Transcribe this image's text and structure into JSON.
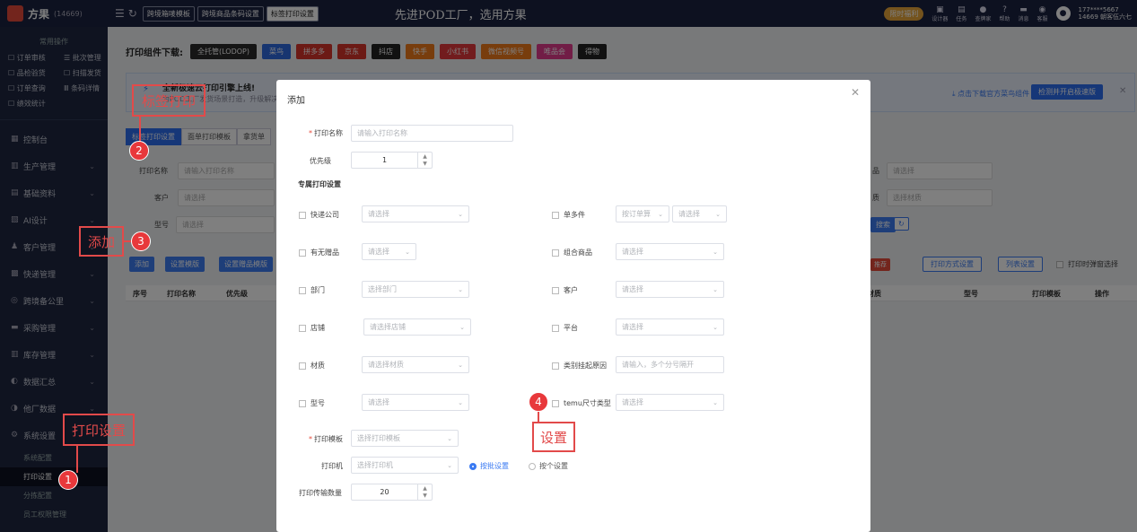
{
  "topbar": {
    "brand": "方果",
    "brand_id": "(14669)",
    "tabs": [
      "跨境箱唛模板",
      "跨境商品条码设置",
      "标签打印设置"
    ],
    "banner": "先进POD工厂，选用方果",
    "promo": "限时福利",
    "icons": [
      {
        "label": "设计器",
        "icon": "design-icon"
      },
      {
        "label": "任务",
        "icon": "task-icon"
      },
      {
        "label": "查牌家",
        "icon": "search-icon"
      },
      {
        "label": "帮助",
        "icon": "help-icon"
      },
      {
        "label": "消息",
        "icon": "message-icon"
      },
      {
        "label": "客服",
        "icon": "service-icon"
      }
    ],
    "user_phone": "177****5667",
    "user_name": "14669 朝客伍六七"
  },
  "sidebar": {
    "section_title": "常用操作",
    "quick": [
      "订单审核",
      "批次管理",
      "品检验货",
      "扫描发货",
      "订单查询",
      "条码详情",
      "绩效统计"
    ],
    "nav": [
      {
        "label": "控制台",
        "icon": "dashboard-icon"
      },
      {
        "label": "生产管理",
        "icon": "production-icon"
      },
      {
        "label": "基础资料",
        "icon": "basic-data-icon"
      },
      {
        "label": "AI设计",
        "icon": "ai-design-icon"
      },
      {
        "label": "客户管理",
        "icon": "customer-icon"
      },
      {
        "label": "快递管理",
        "icon": "express-icon"
      },
      {
        "label": "跨境备公里",
        "icon": "cross-border-icon"
      },
      {
        "label": "采购管理",
        "icon": "purchase-icon"
      },
      {
        "label": "库存管理",
        "icon": "inventory-icon"
      },
      {
        "label": "数据汇总",
        "icon": "data-icon"
      },
      {
        "label": "他厂数据",
        "icon": "other-factory-icon"
      },
      {
        "label": "系统设置",
        "icon": "settings-icon"
      }
    ],
    "sub": [
      "系统配置",
      "打印设置",
      "分拣配置",
      "员工权限管理"
    ]
  },
  "main": {
    "download_label": "打印组件下载:",
    "downloads": [
      {
        "label": "全托管(LODOP)",
        "color": "#2b2b2b"
      },
      {
        "label": "菜鸟",
        "color": "#2f6be0"
      },
      {
        "label": "拼多多",
        "color": "#d9342b"
      },
      {
        "label": "京东",
        "color": "#d9342b"
      },
      {
        "label": "抖店",
        "color": "#222222"
      },
      {
        "label": "快手",
        "color": "#f07a1a"
      },
      {
        "label": "小红书",
        "color": "#e4393c"
      },
      {
        "label": "微信视频号",
        "color": "#f07a1a"
      },
      {
        "label": "唯品会",
        "color": "#e23a8c"
      },
      {
        "label": "得物",
        "color": "#222222"
      }
    ],
    "notice_title": "全新极速云打印引擎上线!",
    "notice_sub": "为POD工厂发货场景打造，升级解决...",
    "notice_link": "点击下载官方菜鸟组件",
    "notice_button": "检测并开启极速版",
    "tabs": [
      "标签打印设置",
      "面单打印模板",
      "拿货单"
    ],
    "filters": {
      "print_name": "打印名称",
      "print_name_ph": "请输入打印名称",
      "customer": "客户",
      "model": "型号",
      "placeholder": "请选择",
      "right_label1": "品",
      "right_label2": "质",
      "right_ph2": "选择材质",
      "search": "搜索",
      "refresh_icon": "refresh-icon"
    },
    "actions": [
      "添加",
      "设置模版",
      "设置赠品模版"
    ],
    "right_actions": {
      "badge": "推荐",
      "print_method": "打印方式设置",
      "columns": "列表设置",
      "remember": "打印时弹窗选择"
    },
    "columns_left": [
      "序号",
      "打印名称",
      "优先级"
    ],
    "columns_right": [
      "材质",
      "型号",
      "打印模板",
      "操作"
    ]
  },
  "modal": {
    "title": "添加",
    "print_name_label": "打印名称",
    "print_name_ph": "请输入打印名称",
    "priority_label": "优先级",
    "priority_value": "1",
    "section": "专属打印设置",
    "left_fields": [
      {
        "label": "快递公司",
        "placeholder": "请选择"
      },
      {
        "label": "有无赠品",
        "placeholder": "请选择"
      },
      {
        "label": "部门",
        "placeholder": "选择部门"
      },
      {
        "label": "店铺",
        "placeholder": "请选择店铺"
      },
      {
        "label": "材质",
        "placeholder": "请选择材质"
      },
      {
        "label": "型号",
        "placeholder": "请选择"
      }
    ],
    "right_fields": [
      {
        "label": "单多件",
        "placeholder": "按订单算"
      },
      {
        "label": "组合商品",
        "placeholder": "请选择"
      },
      {
        "label": "客户",
        "placeholder": "请选择"
      },
      {
        "label": "平台",
        "placeholder": "请选择"
      },
      {
        "label": "类别挂起原因",
        "placeholder": "请输入，多个分号隔开"
      },
      {
        "label": "temu尺寸类型",
        "placeholder": "请选择"
      }
    ],
    "single_multi_second": "请选择",
    "template_label": "打印模板",
    "template_ph": "选择打印模板",
    "printer_label": "打印机",
    "printer_ph": "选择打印机",
    "radio_batch": "按批设置",
    "radio_single": "按个设置",
    "transfer_label": "打印传输数量",
    "transfer_value": "20"
  },
  "annotations": {
    "a1": "打印设置",
    "a2": "标签打印",
    "a3": "添加",
    "a4": "设置",
    "n1": "1",
    "n2": "2",
    "n3": "3",
    "n4": "4"
  }
}
